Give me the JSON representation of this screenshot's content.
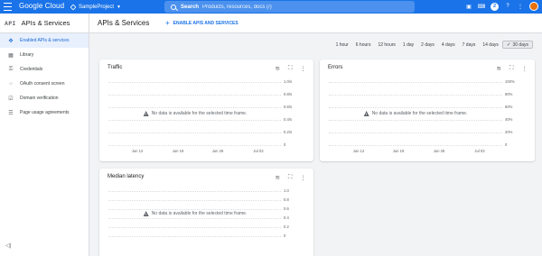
{
  "topbar": {
    "logo": "Google Cloud",
    "project": "SampleProject",
    "search_label": "Search",
    "search_placeholder": "Products, resources, docs (/)",
    "notification_count": "2"
  },
  "sidebar": {
    "logo_text": "API",
    "title": "APIs & Services",
    "items": [
      {
        "label": "Enabled APIs & services",
        "icon": "api-diamond-icon",
        "glyph": "✥",
        "active": true
      },
      {
        "label": "Library",
        "icon": "library-icon",
        "glyph": "▦",
        "active": false
      },
      {
        "label": "Credentials",
        "icon": "key-icon",
        "glyph": "⚿",
        "active": false
      },
      {
        "label": "OAuth consent screen",
        "icon": "consent-icon",
        "glyph": "⁘",
        "active": false
      },
      {
        "label": "Domain verification",
        "icon": "domain-icon",
        "glyph": "☑",
        "active": false
      },
      {
        "label": "Page usage agreements",
        "icon": "agreements-icon",
        "glyph": "☰",
        "active": false
      }
    ],
    "collapse_glyph": "◁|"
  },
  "header": {
    "title": "APIs & Services",
    "enable_button": "ENABLE APIS AND SERVICES"
  },
  "time_ranges": [
    "1 hour",
    "6 hours",
    "12 hours",
    "1 day",
    "2 days",
    "4 days",
    "7 days",
    "14 days",
    "30 days"
  ],
  "selected_range": "30 days",
  "cards": {
    "traffic": {
      "title": "Traffic",
      "y_ticks": [
        "1.0/s",
        "0.8/s",
        "0.6/s",
        "0.4/s",
        "0.2/s",
        "0"
      ],
      "x_ticks": [
        "Jun 12",
        "Jun 19",
        "Jun 26",
        "Jul 03"
      ],
      "no_data": "No data is available for the selected time frame."
    },
    "errors": {
      "title": "Errors",
      "y_ticks": [
        "100%",
        "80%",
        "60%",
        "40%",
        "20%",
        "0"
      ],
      "x_ticks": [
        "Jun 12",
        "Jun 19",
        "Jun 26",
        "Jul 03"
      ],
      "no_data": "No data is available for the selected time frame."
    },
    "latency": {
      "title": "Median latency",
      "y_ticks": [
        "1.0",
        "0.8",
        "0.6",
        "0.4",
        "0.2",
        "0"
      ],
      "x_ticks": [],
      "no_data": "No data is available for the selected time frame."
    }
  },
  "colors": {
    "brand_blue": "#1a73e8",
    "active_bg": "#e8f0fe",
    "page_bg": "#f1f3f4"
  }
}
